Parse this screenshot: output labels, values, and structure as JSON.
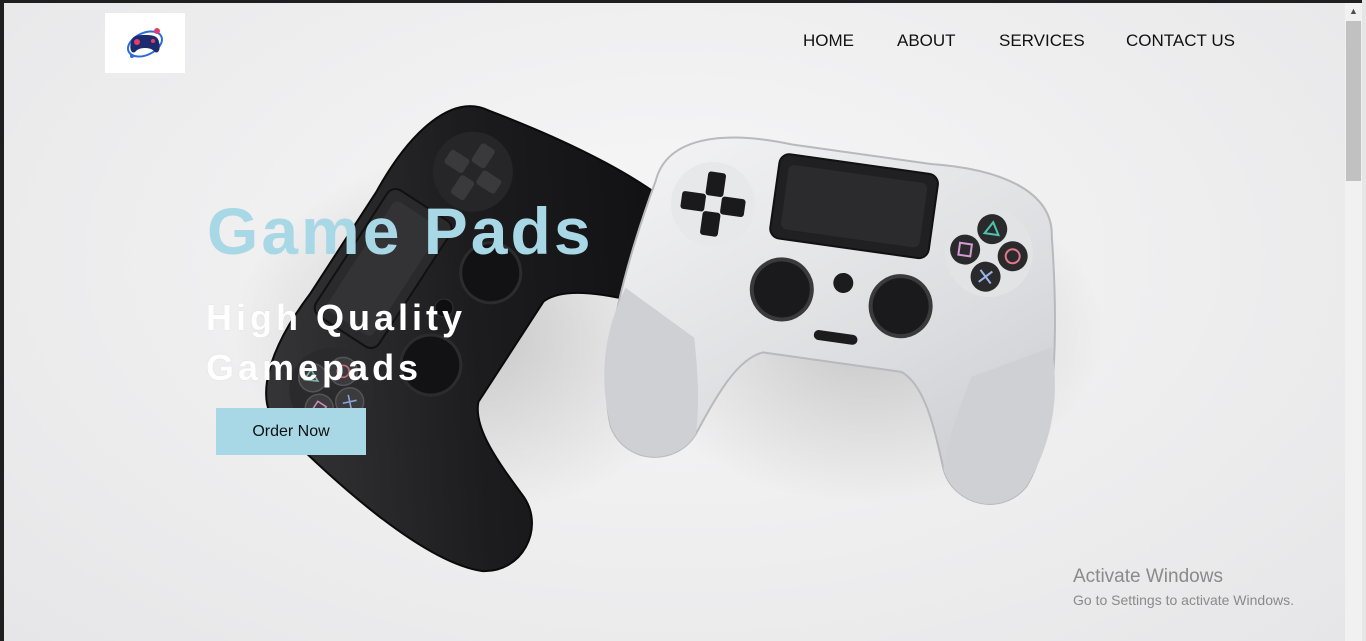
{
  "nav": {
    "items": [
      {
        "label": "HOME"
      },
      {
        "label": "ABOUT"
      },
      {
        "label": "SERVICES"
      },
      {
        "label": "CONTACT US"
      }
    ]
  },
  "hero": {
    "title": "Game Pads",
    "subtitle": "High Quality Gamepads",
    "cta_label": "Order Now"
  },
  "watermark": {
    "title": "Activate Windows",
    "subtitle": "Go to Settings to activate Windows."
  },
  "colors": {
    "accent": "#a8d8e6",
    "nav_text": "#111111",
    "hero_background": "#eeeeef"
  },
  "icons": {
    "logo": "gamepad-logo-icon",
    "scroll_up": "chevron-up-icon"
  }
}
